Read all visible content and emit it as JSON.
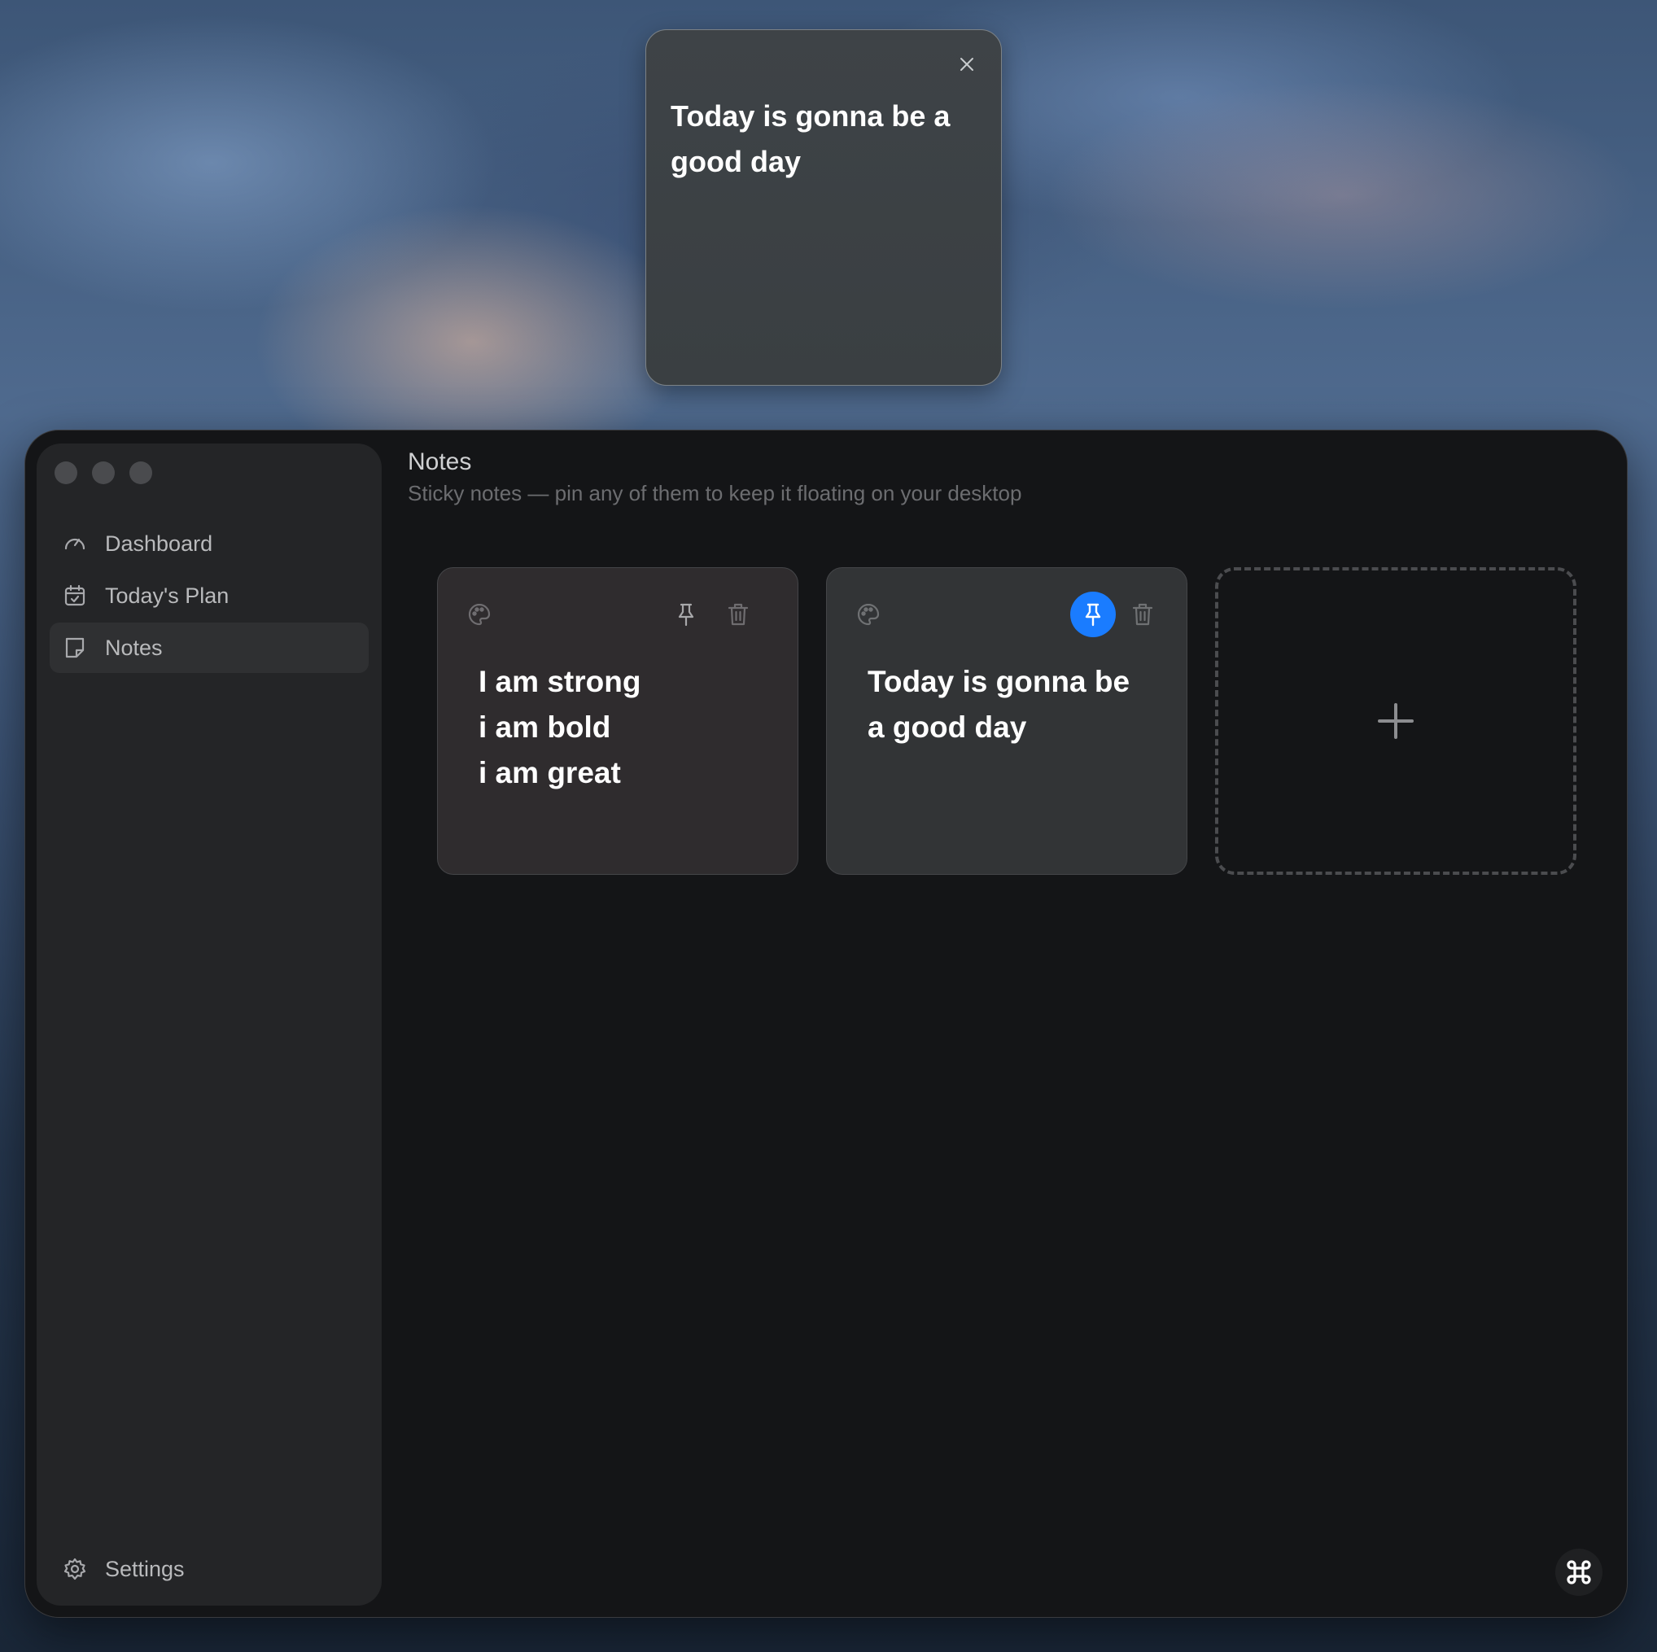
{
  "floating_note": {
    "text": "Today is gonna be a good day",
    "close_icon": "close-icon"
  },
  "sidebar": {
    "items": [
      {
        "label": "Dashboard",
        "icon": "gauge-icon"
      },
      {
        "label": "Today's Plan",
        "icon": "calendar-check-icon"
      },
      {
        "label": "Notes",
        "icon": "note-icon",
        "active": true
      }
    ],
    "settings_label": "Settings"
  },
  "header": {
    "title": "Notes",
    "subtitle": "Sticky notes — pin any of them to keep it floating on your desktop"
  },
  "notes": [
    {
      "text": "I am strong\ni am bold\ni am great",
      "pinned": false,
      "bg": "#2f2c2e"
    },
    {
      "text": "Today is gonna be a good day",
      "pinned": true,
      "bg": "#323436"
    }
  ],
  "colors": {
    "pin_active": "#1a7cff",
    "window_bg": "#141517",
    "sidebar_bg": "#242527"
  }
}
